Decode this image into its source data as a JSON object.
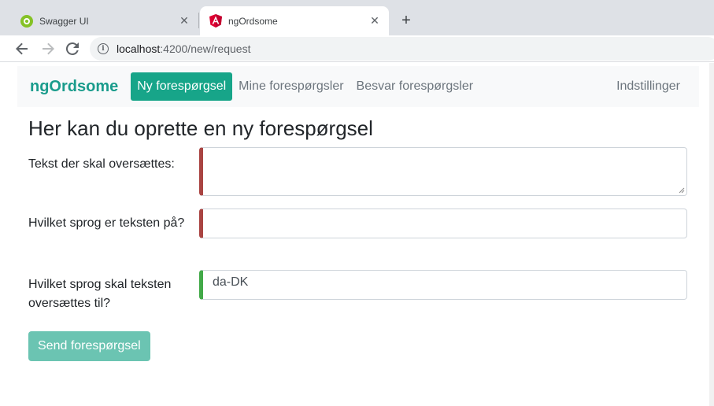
{
  "browser": {
    "tabs": [
      {
        "title": "Swagger UI",
        "icon": "swagger-globe-icon"
      },
      {
        "title": "ngOrdsome",
        "icon": "angular-icon"
      }
    ],
    "url_host": "localhost",
    "url_path": ":4200/new/request"
  },
  "navbar": {
    "brand": "ngOrdsome",
    "links": [
      "Ny forespørgsel",
      "Mine forespørgsler",
      "Besvar forespørgsler"
    ],
    "settings": "Indstillinger"
  },
  "page": {
    "heading": "Her kan du oprette en ny forespørgsel",
    "fields": {
      "text_label": "Tekst der skal oversættes:",
      "text_value": "",
      "source_label": "Hvilket sprog er teksten på?",
      "source_value": "",
      "target_label": "Hvilket sprog skal teksten oversættes til?",
      "target_value": "da-DK"
    },
    "submit_label": "Send forespørgsel"
  },
  "colors": {
    "brand": "#1a9c8c",
    "active_nav": "#17a589",
    "invalid": "#a94442",
    "valid": "#42a948",
    "submit_disabled": "#6bc4b2"
  }
}
